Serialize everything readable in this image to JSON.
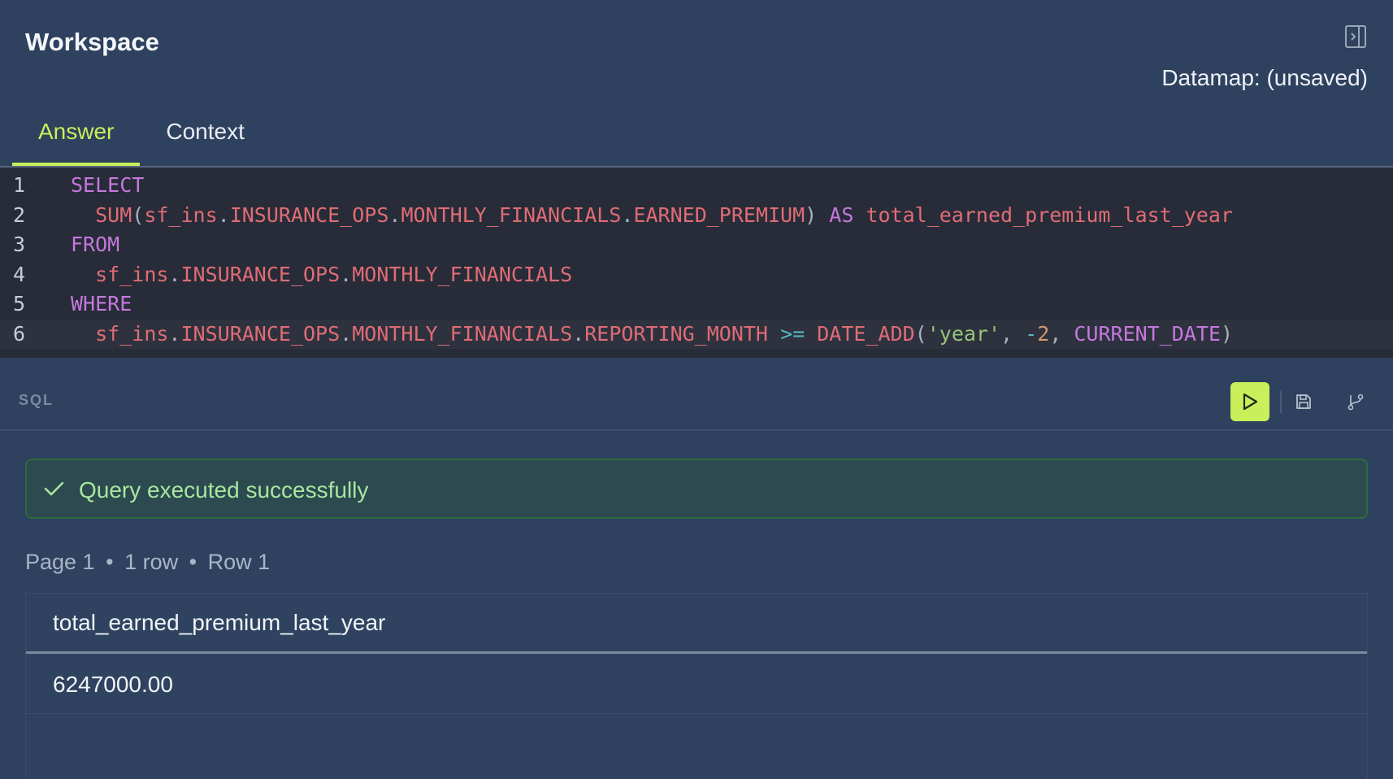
{
  "header": {
    "title": "Workspace",
    "datamap_label": "Datamap: (unsaved)",
    "panel_toggle_icon": "panel-right-icon"
  },
  "tabs": [
    {
      "label": "Answer",
      "active": true
    },
    {
      "label": "Context",
      "active": false
    }
  ],
  "editor": {
    "language_label": "SQL",
    "current_line": 6,
    "lines": [
      {
        "number": "1",
        "indent": "",
        "tokens": [
          [
            "kw",
            "SELECT"
          ]
        ]
      },
      {
        "number": "2",
        "indent": "  ",
        "tokens": [
          [
            "ident",
            "SUM"
          ],
          [
            "punc",
            "("
          ],
          [
            "ident",
            "sf_ins"
          ],
          [
            "punc",
            "."
          ],
          [
            "ident",
            "INSURANCE_OPS"
          ],
          [
            "punc",
            "."
          ],
          [
            "ident",
            "MONTHLY_FINANCIALS"
          ],
          [
            "punc",
            "."
          ],
          [
            "ident",
            "EARNED_PREMIUM"
          ],
          [
            "punc",
            ")"
          ],
          [
            "plain",
            " "
          ],
          [
            "kw",
            "AS"
          ],
          [
            "plain",
            " "
          ],
          [
            "ident",
            "total_earned_premium_last_year"
          ]
        ]
      },
      {
        "number": "3",
        "indent": "",
        "tokens": [
          [
            "kw",
            "FROM"
          ]
        ]
      },
      {
        "number": "4",
        "indent": "  ",
        "tokens": [
          [
            "ident",
            "sf_ins"
          ],
          [
            "punc",
            "."
          ],
          [
            "ident",
            "INSURANCE_OPS"
          ],
          [
            "punc",
            "."
          ],
          [
            "ident",
            "MONTHLY_FINANCIALS"
          ]
        ]
      },
      {
        "number": "5",
        "indent": "",
        "tokens": [
          [
            "kw",
            "WHERE"
          ]
        ]
      },
      {
        "number": "6",
        "indent": "  ",
        "tokens": [
          [
            "ident",
            "sf_ins"
          ],
          [
            "punc",
            "."
          ],
          [
            "ident",
            "INSURANCE_OPS"
          ],
          [
            "punc",
            "."
          ],
          [
            "ident",
            "MONTHLY_FINANCIALS"
          ],
          [
            "punc",
            "."
          ],
          [
            "ident",
            "REPORTING_MONTH"
          ],
          [
            "plain",
            " "
          ],
          [
            "op",
            ">="
          ],
          [
            "plain",
            " "
          ],
          [
            "ident",
            "DATE_ADD"
          ],
          [
            "punc",
            "("
          ],
          [
            "str",
            "'year'"
          ],
          [
            "punc",
            ", "
          ],
          [
            "op",
            "-"
          ],
          [
            "num",
            "2"
          ],
          [
            "punc",
            ", "
          ],
          [
            "kw",
            "CURRENT_DATE"
          ],
          [
            "punc",
            ")"
          ]
        ]
      }
    ]
  },
  "toolbar": {
    "run_icon": "play-icon",
    "save_icon": "save-icon",
    "branch_icon": "git-branch-icon"
  },
  "result": {
    "status_text": "Query executed successfully",
    "status_icon": "check-icon",
    "page_label": "Page 1",
    "rows_label": "1 row",
    "row_label": "Row 1",
    "separator": "•",
    "columns": [
      "total_earned_premium_last_year"
    ],
    "rows": [
      [
        "6247000.00"
      ]
    ]
  },
  "colors": {
    "accent": "#c9ef5a",
    "background": "#2e415e",
    "editor_bg": "#272c38",
    "success_text": "#a9e6a0"
  }
}
